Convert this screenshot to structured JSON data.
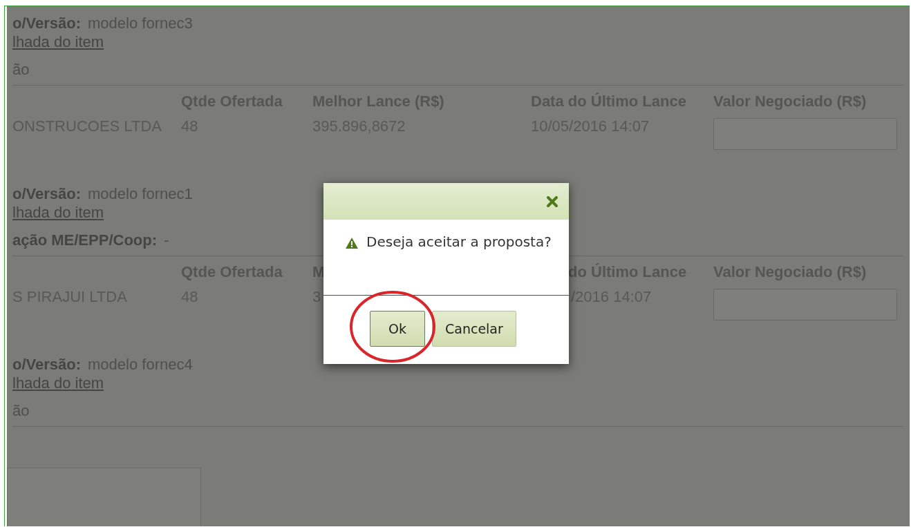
{
  "proposals": [
    {
      "model_label": "o/Versão:",
      "model_value": "modelo fornec3",
      "detail_link": "lhada do item",
      "info_label": "ão",
      "table": {
        "headers": [
          {
            "text": "Qtde Ofertada",
            "covered_start": false
          },
          {
            "text": "Melhor Lance (R$)",
            "covered_start": false
          },
          {
            "text": "Data do Último Lance",
            "covered_start": false
          },
          {
            "text": "Valor Negociado (R$)",
            "covered_start": false
          }
        ],
        "cells": [
          {
            "text": "ONSTRUCOES LTDA",
            "covered_start": false
          },
          {
            "text": "48",
            "covered_start": false
          },
          {
            "text": "395.896,8672",
            "covered_start": false
          },
          {
            "text": "10/05/2016 14:07",
            "covered_start": false
          }
        ]
      }
    },
    {
      "model_label": "o/Versão:",
      "model_value": "modelo fornec1",
      "detail_link": "lhada do item",
      "info_label": "ação ME/EPP/Coop:",
      "info_value": "-",
      "table": {
        "headers": [
          {
            "text": "Qtde Ofertada",
            "covered_start": false
          },
          {
            "text": "M",
            "covered_start": false
          },
          {
            "text": "do Último Lance",
            "covered_start": true
          },
          {
            "text": "Valor Negociado (R$)",
            "covered_start": false
          }
        ],
        "cells": [
          {
            "text": "S PIRAJUI LTDA",
            "covered_start": false
          },
          {
            "text": "48",
            "covered_start": false
          },
          {
            "text": "3",
            "covered_start": false
          },
          {
            "text": "/2016 14:07",
            "covered_start": true
          }
        ]
      }
    },
    {
      "model_label": "o/Versão:",
      "model_value": "modelo fornec4",
      "detail_link": "lhada do item",
      "info_label": "ão"
    }
  ],
  "dialog": {
    "message": "Deseja aceitar a proposta?",
    "buttons": [
      "Ok",
      "Cancelar"
    ]
  }
}
